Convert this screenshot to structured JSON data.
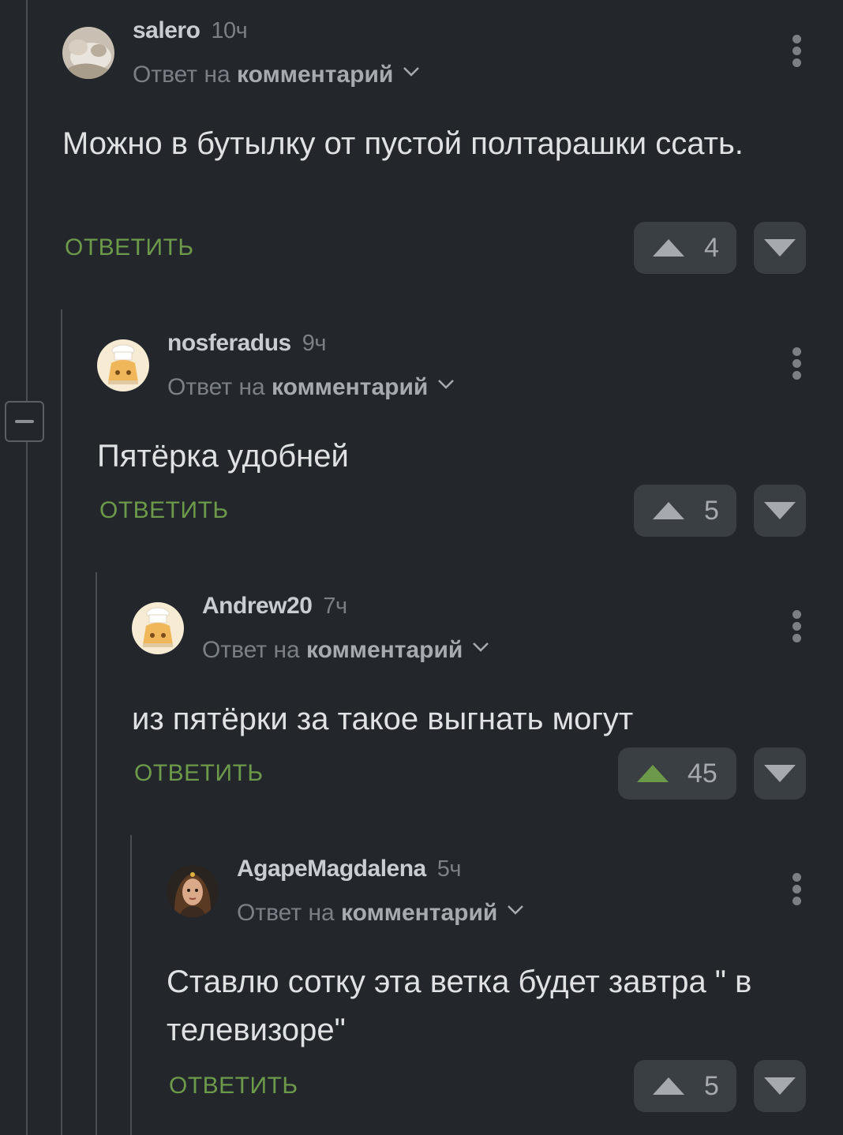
{
  "comments": [
    {
      "username": "salero",
      "time": "10ч",
      "reply_prefix": "Ответ на",
      "reply_target": "комментарий",
      "text": "Можно в бутылку от пустой полтарашки ссать.",
      "reply_label": "ОТВЕТИТЬ",
      "votes": "4"
    },
    {
      "username": "nosferadus",
      "time": "9ч",
      "reply_prefix": "Ответ на",
      "reply_target": "комментарий",
      "text": "Пятёрка удобней",
      "reply_label": "ОТВЕТИТЬ",
      "votes": "5"
    },
    {
      "username": "Andrew20",
      "time": "7ч",
      "reply_prefix": "Ответ на",
      "reply_target": "комментарий",
      "text": "из пятёрки за такое выгнать могут",
      "reply_label": "ОТВЕТИТЬ",
      "votes": "45"
    },
    {
      "username": "AgapeMagdalena",
      "time": "5ч",
      "reply_prefix": "Ответ на",
      "reply_target": "комментарий",
      "text": "Ставлю сотку эта ветка будет завтра \" в телевизоре\"",
      "reply_label": "ОТВЕТИТЬ",
      "votes": "5"
    }
  ],
  "colors": {
    "background": "#23272b",
    "accent_green": "#6d9a4a",
    "button_bg": "#3a3f44"
  }
}
